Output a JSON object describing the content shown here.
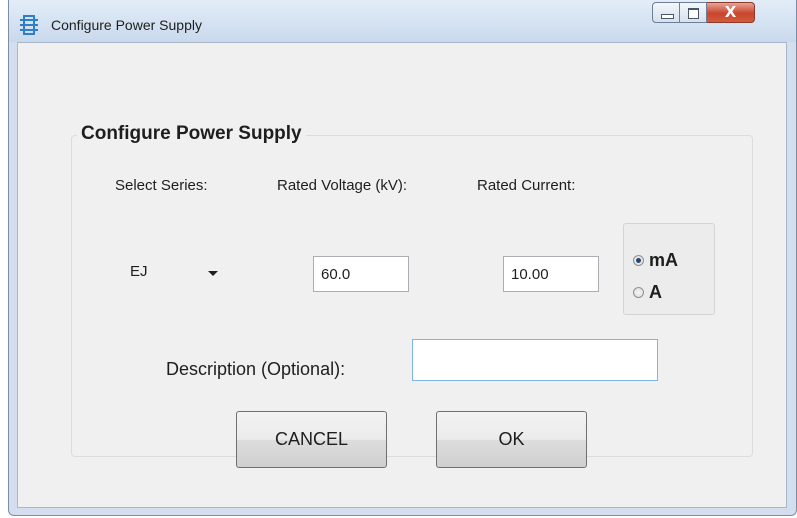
{
  "window": {
    "title": "Configure Power Supply",
    "icon": "app-circuit-icon",
    "close_glyph": "X"
  },
  "group": {
    "title": "Configure Power Supply"
  },
  "series": {
    "label": "Select Series:",
    "selected": "EJ"
  },
  "voltage": {
    "label": "Rated Voltage (kV):",
    "value": "60.0"
  },
  "current": {
    "label": "Rated Current:",
    "value": "10.00"
  },
  "units": {
    "options": [
      "mA",
      "A"
    ],
    "selected": "mA"
  },
  "description": {
    "label": "Description (Optional):",
    "value": ""
  },
  "buttons": {
    "cancel": "CANCEL",
    "ok": "OK"
  },
  "colors": {
    "close_button": "#c8452c",
    "radio_dot": "#26466d",
    "input_focus_border": "#7eb4ea"
  }
}
